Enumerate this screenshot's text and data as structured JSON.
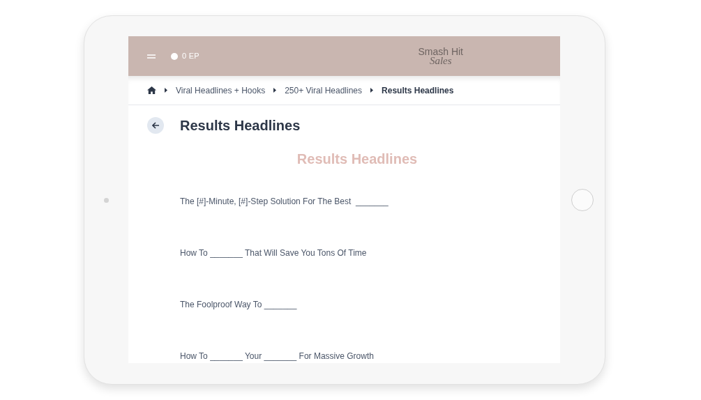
{
  "header": {
    "points": "0 EP",
    "logo_top": "Smash Hit",
    "logo_bottom": "Sales"
  },
  "breadcrumb": [
    {
      "label": "Viral Headlines + Hooks",
      "current": false
    },
    {
      "label": "250+ Viral Headlines",
      "current": false
    },
    {
      "label": "Results Headlines",
      "current": true
    }
  ],
  "page_title": "Results Headlines",
  "section_heading": "Results Headlines",
  "headlines": [
    "The [#]-Minute, [#]-Step Solution For The Best  _______",
    "How To _______ That Will Save You Tons Of Time",
    "The Foolproof Way To _______",
    "How To _______ Your _______ For Massive Growth"
  ]
}
